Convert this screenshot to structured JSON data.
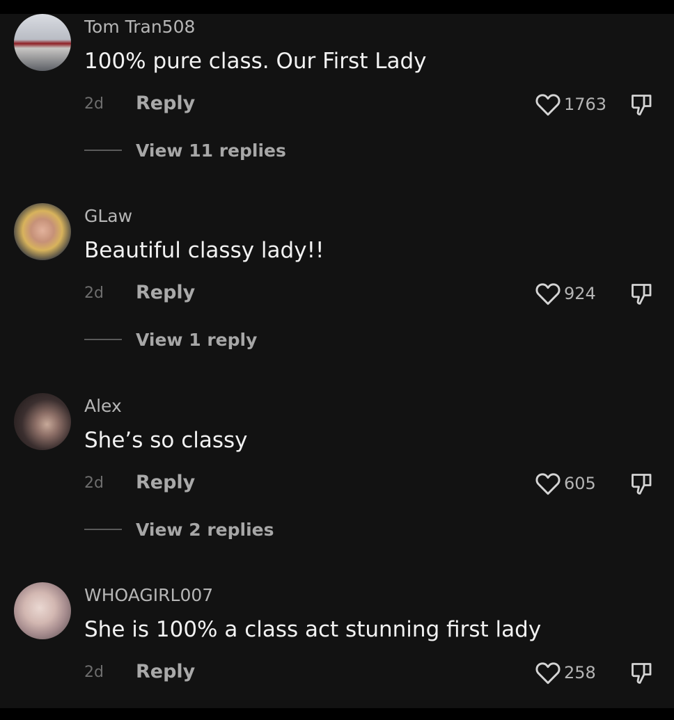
{
  "comments": [
    {
      "username": "Tom Tran508",
      "text": "100% pure class. Our First Lady",
      "age": "2d",
      "reply_label": "Reply",
      "likes": "1763",
      "view_replies": "View 11 replies",
      "avatar_icon": "profile-photo-storefront"
    },
    {
      "username": "GLaw",
      "text": "Beautiful classy lady!!",
      "age": "2d",
      "reply_label": "Reply",
      "likes": "924",
      "view_replies": "View 1 reply",
      "avatar_icon": "profile-photo-woman"
    },
    {
      "username": "Alex",
      "text": "She’s so classy",
      "age": "2d",
      "reply_label": "Reply",
      "likes": "605",
      "view_replies": "View 2 replies",
      "avatar_icon": "profile-photo-selfie"
    },
    {
      "username": "WHOAGIRL007",
      "text": "She is 100% a class act stunning first lady",
      "age": "2d",
      "reply_label": "Reply",
      "likes": "258",
      "view_replies": "",
      "avatar_icon": "profile-photo-blonde"
    }
  ],
  "icons": {
    "like": "heart-outline-icon",
    "dislike": "thumbs-down-outline-icon"
  },
  "colors": {
    "background": "#121212",
    "frame": "#000000",
    "text_primary": "#f2f2f2",
    "text_secondary": "#b6b6b6",
    "text_muted": "#6e6e6e"
  }
}
